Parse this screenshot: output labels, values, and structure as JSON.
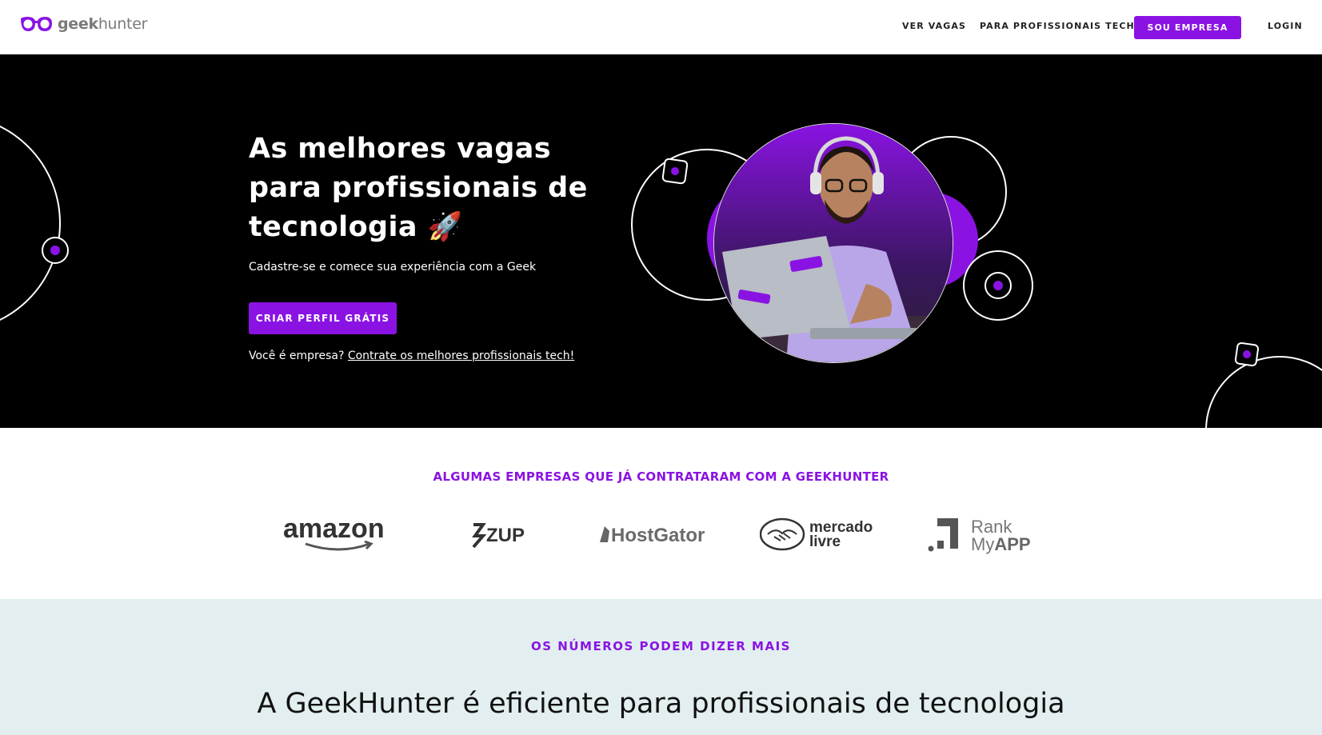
{
  "nav": {
    "brand_bold": "geek",
    "brand_rest": "hunter",
    "links": [
      "VER VAGAS",
      "PARA PROFISSIONAIS TECH"
    ],
    "cta": "SOU EMPRESA",
    "login": "LOGIN"
  },
  "hero": {
    "title": "As melhores vagas para profissionais de tecnologia 🚀",
    "subtitle": "Cadastre-se e comece sua experiência com a Geek",
    "cta": "CRIAR PERFIL GRÁTIS",
    "company_prompt": "Você é empresa?",
    "company_link": "Contrate os melhores profissionais tech!"
  },
  "clients": {
    "title": "ALGUMAS EMPRESAS QUE JÁ CONTRATARAM COM A GEEKHUNTER",
    "logos": [
      "amazon",
      "ZUP",
      "HostGator",
      "mercado livre",
      "Rank MyAPP"
    ]
  },
  "numbers": {
    "kicker": "OS NÚMEROS PODEM DIZER MAIS",
    "title": "A GeekHunter é eficiente para profissionais de tecnologia"
  },
  "colors": {
    "accent": "#8a13e3",
    "hero_bg": "#000000",
    "numbers_bg": "#e2eef0"
  }
}
